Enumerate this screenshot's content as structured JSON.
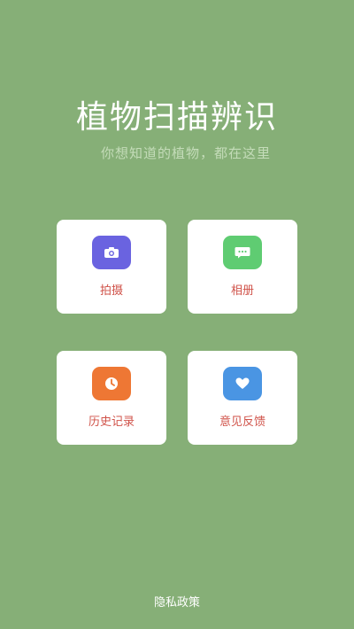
{
  "header": {
    "title": "植物扫描辨识",
    "subtitle": "你想知道的植物，都在这里"
  },
  "menu": {
    "camera": {
      "label": "拍摄",
      "icon": "camera-icon",
      "color": "#6a63e0"
    },
    "album": {
      "label": "相册",
      "icon": "chat-bubble-icon",
      "color": "#5fcc72"
    },
    "history": {
      "label": "历史记录",
      "icon": "clock-icon",
      "color": "#ee7734"
    },
    "feedback": {
      "label": "意见反馈",
      "icon": "heart-icon",
      "color": "#4a95e3"
    }
  },
  "footer": {
    "privacy_label": "隐私政策"
  },
  "colors": {
    "background": "#86af77",
    "label_text": "#d0534a"
  }
}
